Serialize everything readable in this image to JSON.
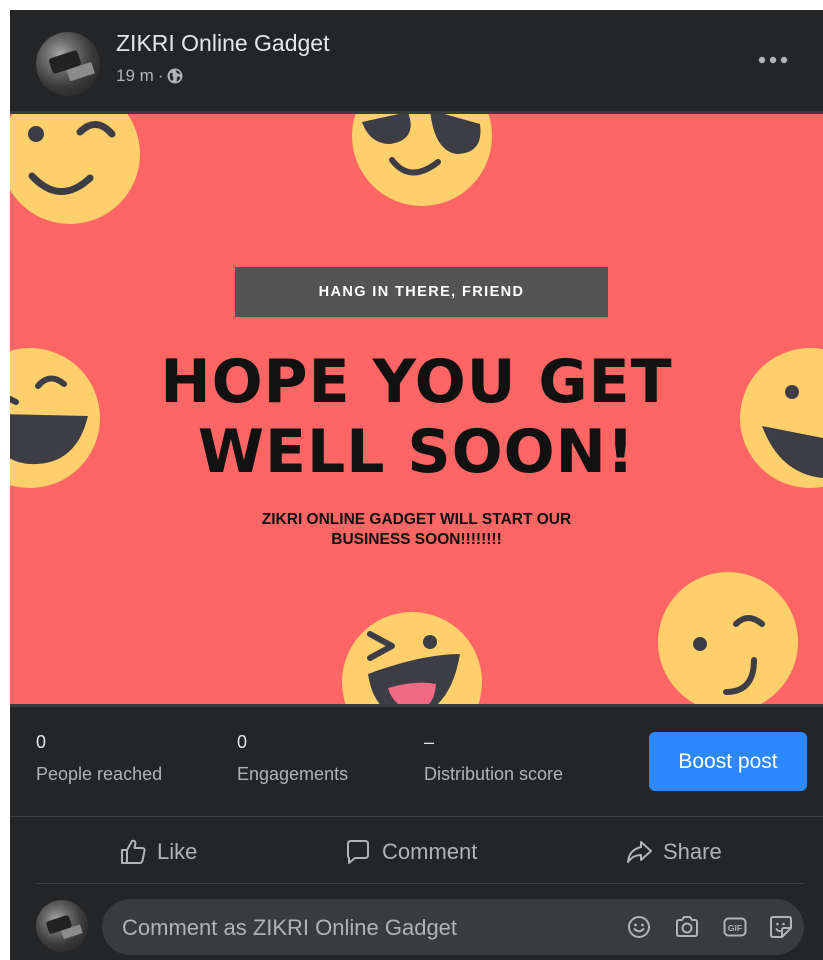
{
  "post": {
    "page_name": "ZIKRI Online Gadget",
    "time": "19 m",
    "separator": "·",
    "privacy_icon": "globe-icon",
    "more_icon": "more-dots-icon"
  },
  "image": {
    "banner_text": "HANG IN THERE, FRIEND",
    "headline_line1": "HOPE YOU GET",
    "headline_line2": "WELL SOON!",
    "subline_line1": "ZIKRI ONLINE GADGET WILL START OUR",
    "subline_line2": "BUSINESS SOON!!!!!!!!",
    "colors": {
      "background": "#fe6565",
      "banner": "#545454",
      "emoji": "#fdd06b",
      "emoji_feature": "#3d3d45"
    }
  },
  "stats": {
    "people_reached": {
      "value": "0",
      "label": "People reached"
    },
    "engagements": {
      "value": "0",
      "label": "Engagements"
    },
    "distribution": {
      "value": "–",
      "label": "Distribution score"
    },
    "boost_label": "Boost post"
  },
  "actions": {
    "like": "Like",
    "comment": "Comment",
    "share": "Share"
  },
  "comment_box": {
    "placeholder": "Comment as ZIKRI Online Gadget",
    "icons": [
      "emoji-icon",
      "camera-icon",
      "gif-icon",
      "sticker-icon"
    ]
  },
  "colors": {
    "card_bg": "#242526",
    "accent": "#2d88ff"
  }
}
